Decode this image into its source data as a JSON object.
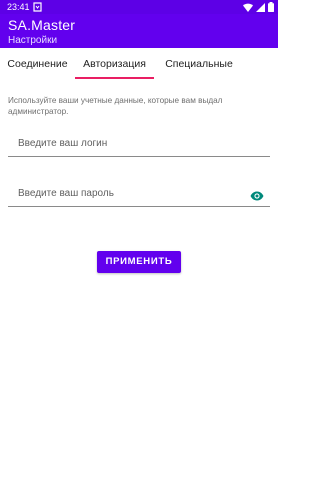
{
  "status_bar": {
    "time": "23:41",
    "left_icon": "notification-icon",
    "icons": [
      "wifi-icon",
      "signal-icon",
      "battery-icon"
    ]
  },
  "app_bar": {
    "title": "SA.Master",
    "subtitle": "Настройки"
  },
  "tabs": [
    {
      "label": "Соединение",
      "selected": false
    },
    {
      "label": "Авторизация",
      "selected": true
    },
    {
      "label": "Специальные",
      "selected": false
    }
  ],
  "form": {
    "hint": "Используйте ваши учетные данные, которые вам выдал администратор.",
    "login": {
      "value": "",
      "placeholder": "Введите ваш логин"
    },
    "password": {
      "value": "",
      "placeholder": "Введите ваш пароль",
      "toggle_icon": "visibility-icon"
    },
    "apply_label": "ПРИМЕНИТЬ"
  },
  "colors": {
    "primary": "#6200ee",
    "status_bar": "#5d00e6",
    "tab_indicator": "#e91e63",
    "eye_icon": "#00897b"
  }
}
